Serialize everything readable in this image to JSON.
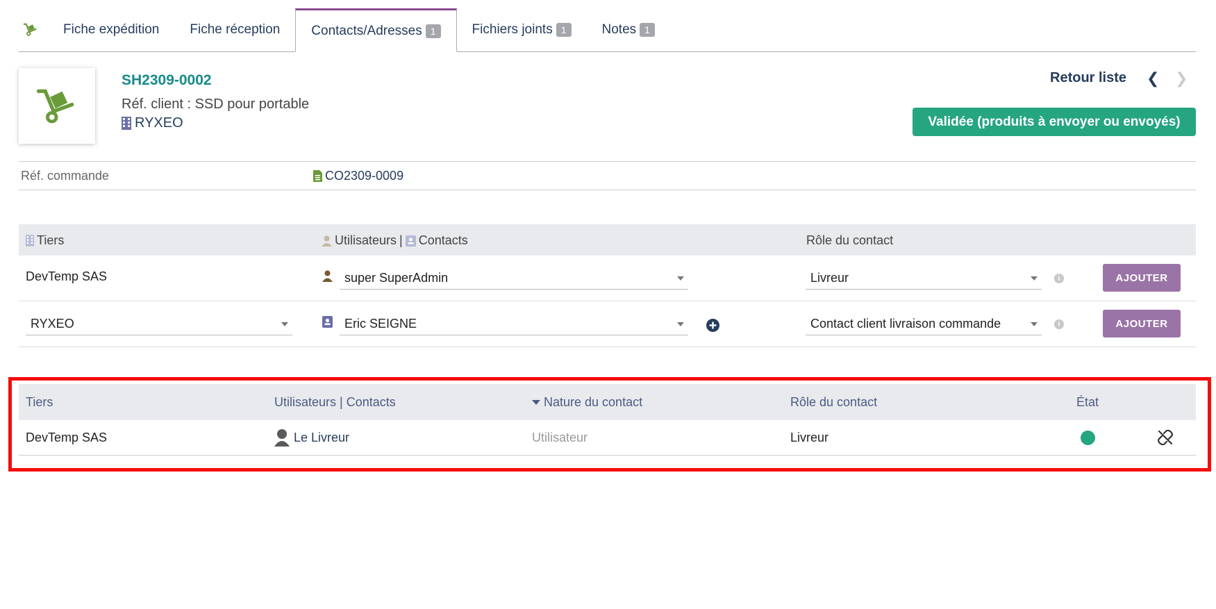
{
  "tabs": [
    {
      "label": "Fiche expédition"
    },
    {
      "label": "Fiche réception"
    },
    {
      "label": "Contacts/Adresses",
      "badge": "1"
    },
    {
      "label": "Fichiers joints",
      "badge": "1"
    },
    {
      "label": "Notes",
      "badge": "1"
    }
  ],
  "header": {
    "ref": "SH2309-0002",
    "ref_client": "Réf. client : SSD pour portable",
    "tiers": "RYXEO",
    "back_label": "Retour liste",
    "status": "Validée (produits à envoyer ou envoyés)"
  },
  "ref_commande": {
    "label": "Réf. commande",
    "value": "CO2309-0009"
  },
  "add_form": {
    "headers": {
      "tiers": "Tiers",
      "users": "Utilisateurs",
      "separator": "|",
      "contacts": "Contacts",
      "role": "Rôle du contact"
    },
    "rows": [
      {
        "tiers": "DevTemp SAS",
        "contact": "super SuperAdmin",
        "role": "Livreur",
        "button": "AJOUTER"
      },
      {
        "tiers": "RYXEO",
        "contact": "Eric SEIGNE",
        "role": "Contact client livraison commande",
        "button": "AJOUTER"
      }
    ]
  },
  "list": {
    "headers": {
      "tiers": "Tiers",
      "users_contacts": "Utilisateurs | Contacts",
      "nature": "Nature du contact",
      "role": "Rôle du contact",
      "etat": "État"
    },
    "rows": [
      {
        "tiers": "DevTemp SAS",
        "contact": "Le Livreur",
        "nature": "Utilisateur",
        "role": "Livreur"
      }
    ]
  },
  "colors": {
    "accent_purple": "#8d4a8f",
    "status_green": "#25a580",
    "button_purple": "#9a74a7",
    "highlight_red": "#f40d0d"
  }
}
